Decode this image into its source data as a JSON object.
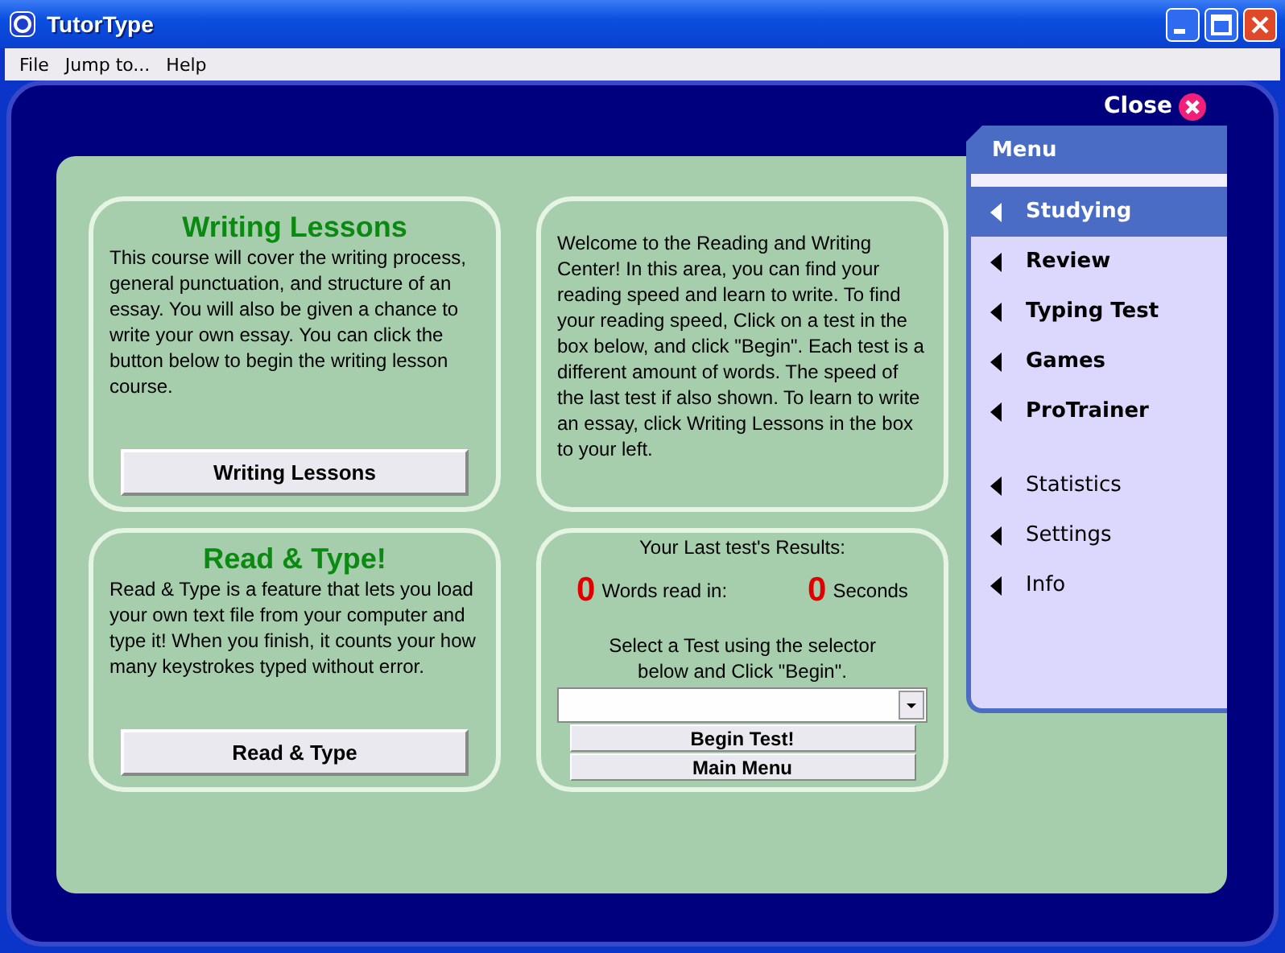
{
  "window": {
    "title": "TutorType"
  },
  "menu_bar": [
    "File",
    "Jump to...",
    "Help"
  ],
  "close_link": "Close",
  "writing_card": {
    "heading": "Writing Lessons",
    "text": "This course will cover the writing process, general punctuation, and structure of an essay. You will also be given a chance to write your own essay. You can click the button below to begin the writing lesson course.",
    "button": "Writing Lessons"
  },
  "welcome_card": {
    "text": "Welcome to the Reading and Writing Center! In this area, you can find your reading speed and learn to write. To find your reading speed, Click on a test in the box below, and click \"Begin\". Each test is a different amount of words. The speed of the last test if also shown. To learn to write an essay, click Writing Lessons in the box to your left."
  },
  "read_card": {
    "heading": "Read & Type!",
    "text": "Read & Type is a feature that lets you load your own text file from your computer and type it! When you finish, it counts your how many keystrokes typed without error.",
    "button": "Read & Type"
  },
  "results_card": {
    "title": "Your Last test's Results:",
    "words_count": "0",
    "words_label": "Words read in:",
    "seconds_count": "0",
    "seconds_label": "Seconds",
    "instructions": "Select a Test using the selector below and Click \"Begin\".",
    "buttons": [
      "Begin Test!",
      "Main Menu"
    ]
  },
  "side_menu": {
    "title": "Menu",
    "items": [
      {
        "label": "Studying",
        "kind": "main",
        "selected": true
      },
      {
        "label": "Review",
        "kind": "main",
        "selected": false
      },
      {
        "label": "Typing Test",
        "kind": "main",
        "selected": false
      },
      {
        "label": "Games",
        "kind": "main",
        "selected": false
      },
      {
        "label": "ProTrainer",
        "kind": "main",
        "selected": false
      },
      {
        "label": "Statistics",
        "kind": "extra",
        "selected": false
      },
      {
        "label": "Settings",
        "kind": "extra",
        "selected": false
      },
      {
        "label": "Info",
        "kind": "extra",
        "selected": false
      }
    ]
  }
}
